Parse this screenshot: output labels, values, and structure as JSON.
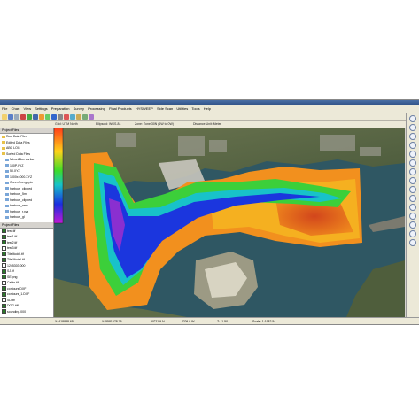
{
  "menu": [
    "File",
    "Chart",
    "View",
    "Settings",
    "Preparation",
    "Survey",
    "Processing",
    "Final Products",
    "HYSWEEP",
    "Side Scan",
    "Utilities",
    "Tools",
    "Help"
  ],
  "top_status": {
    "projection": "Grid: UTM North",
    "ellipsoid": "Ellipsoid: WGS-84",
    "zone": "Zone: Zone 30N (6W to 0W)",
    "units": "Distance Unit: Meter"
  },
  "left_panel": {
    "files_title": "Project Files",
    "files": [
      {
        "label": "Raw Data Files",
        "kind": "folder"
      },
      {
        "label": "Edited Data Files",
        "kind": "folder"
      },
      {
        "label": "ABC LOG",
        "kind": "folder"
      },
      {
        "label": "Sorted Data Files",
        "kind": "folder"
      },
      {
        "label": "Mbnet/Box surfac",
        "kind": "file"
      },
      {
        "label": "100P.XYZ",
        "kind": "file"
      },
      {
        "label": "50.XYZ",
        "kind": "file"
      },
      {
        "label": "1000x1000.XYZ",
        "kind": "file"
      },
      {
        "label": "GreenEnergy.pin",
        "kind": "file"
      },
      {
        "label": "harbour_clipped",
        "kind": "file"
      },
      {
        "label": "harbour_5m",
        "kind": "file"
      },
      {
        "label": "harbour_clipped",
        "kind": "file"
      },
      {
        "label": "harbour_new",
        "kind": "file"
      },
      {
        "label": "harbour_r.xyz",
        "kind": "file"
      },
      {
        "label": "harbour_gl",
        "kind": "file"
      }
    ],
    "layers_title": "Project Files",
    "layers": [
      {
        "label": "test.tif",
        "on": true
      },
      {
        "label": "test1.tif",
        "on": true
      },
      {
        "label": "test2.tif",
        "on": true
      },
      {
        "label": "test3.tif",
        "on": false
      },
      {
        "label": "TileModel.tif",
        "on": true
      },
      {
        "label": "Tile Model.tif",
        "on": true
      },
      {
        "label": "1245303.000",
        "on": false
      },
      {
        "label": "SJ.tif",
        "on": true
      },
      {
        "label": "SE.png",
        "on": true
      },
      {
        "label": "Cabin.tif",
        "on": false
      },
      {
        "label": "contours.DXF",
        "on": true
      },
      {
        "label": "contours_1.DXF",
        "on": true
      },
      {
        "label": "SD.tif",
        "on": false
      },
      {
        "label": "DOG.tiff",
        "on": true
      },
      {
        "label": "sounding.000",
        "on": true
      }
    ]
  },
  "bottom_status": {
    "easting": "X: 418888.65",
    "northing": "Y: 5581578.76",
    "lat": "50°21.9 N",
    "lon": "4°09.9 W",
    "depth": "Z: -1.50",
    "scale": "Scale: 1:1982.54"
  },
  "colors": {
    "water": "#2f5763",
    "land": "#5a6b45",
    "chrome": "#ece9d8"
  }
}
